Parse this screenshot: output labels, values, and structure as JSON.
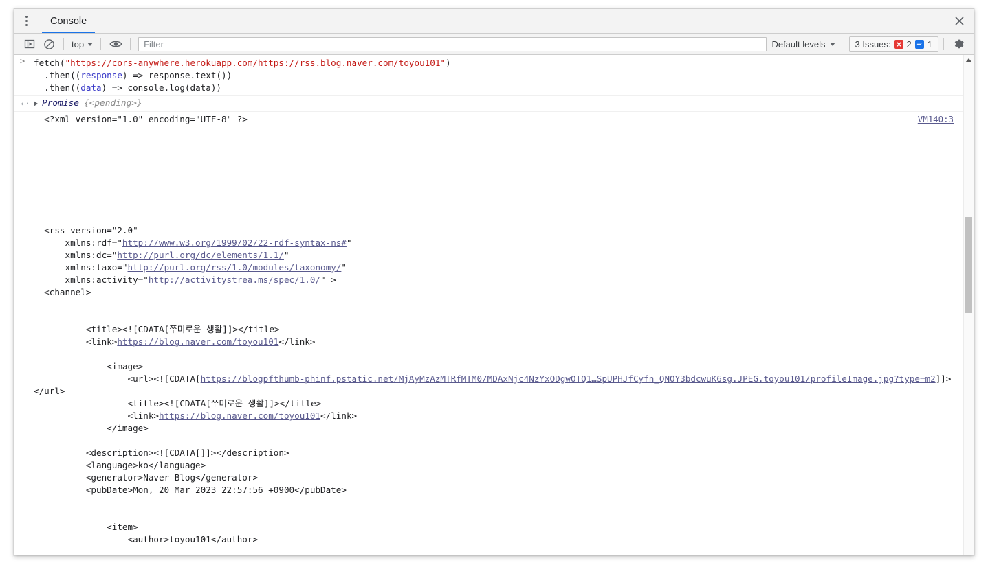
{
  "window": {
    "close_label": "×"
  },
  "tabstrip": {
    "menu_name": "more-options",
    "tabs": [
      {
        "label": "Console",
        "active": true
      }
    ]
  },
  "toolbar": {
    "sidebar_toggle_title": "Show console sidebar",
    "clear_title": "Clear console",
    "context_value": "top",
    "eye_title": "Create live expression",
    "filter_value": "",
    "filter_placeholder": "Filter",
    "levels_label": "Default levels",
    "issues_label": "3 Issues:",
    "issues_error_count": "2",
    "issues_info_count": "1",
    "settings_title": "Console settings"
  },
  "colors": {
    "accent": "#1a73e8",
    "error_badge": "#e53935",
    "info_badge": "#1a73e8",
    "string_token": "#c41a16",
    "variable_token": "#3b3bc9",
    "link": "#5a5a8e",
    "toolbar_bg": "#f3f3f3"
  },
  "console": {
    "command": {
      "gutter": ">",
      "lines": [
        [
          {
            "t": "plain",
            "v": "fetch("
          },
          {
            "t": "str",
            "v": "\"https://cors-anywhere.herokuapp.com/https://rss.blog.naver.com/toyou101\""
          },
          {
            "t": "plain",
            "v": ")"
          }
        ],
        [
          {
            "t": "plain",
            "v": "  .then(("
          },
          {
            "t": "var",
            "v": "response"
          },
          {
            "t": "plain",
            "v": ") => response.text())"
          }
        ],
        [
          {
            "t": "plain",
            "v": "  .then(("
          },
          {
            "t": "var",
            "v": "data"
          },
          {
            "t": "plain",
            "v": ") => console.log(data))"
          }
        ]
      ]
    },
    "result": {
      "gutter": "‹·",
      "name": "Promise",
      "value": "{<pending>}"
    },
    "output": {
      "source_link": "VM140:3",
      "segments": [
        {
          "k": "text",
          "v": "  <?xml version=\"1.0\" encoding=\"UTF-8\" ?>\n\n\n\n\n\n\n\n\n  <rss version=\"2.0\"\n      xmlns:rdf=\""
        },
        {
          "k": "link",
          "v": "http://www.w3.org/1999/02/22-rdf-syntax-ns#"
        },
        {
          "k": "text",
          "v": "\"\n      xmlns:dc=\""
        },
        {
          "k": "link",
          "v": "http://purl.org/dc/elements/1.1/"
        },
        {
          "k": "text",
          "v": "\"\n      xmlns:taxo=\""
        },
        {
          "k": "link",
          "v": "http://purl.org/rss/1.0/modules/taxonomy/"
        },
        {
          "k": "text",
          "v": "\"\n      xmlns:activity=\""
        },
        {
          "k": "link",
          "v": "http://activitystrea.ms/spec/1.0/"
        },
        {
          "k": "text",
          "v": "\" >\n  <channel>\n\n\n          <title><![CDATA[쭈미로운 생활]]></title>\n          <link>"
        },
        {
          "k": "link",
          "v": "https://blog.naver.com/toyou101"
        },
        {
          "k": "text",
          "v": "</link>\n\n              <image>\n                  <url><![CDATA["
        },
        {
          "k": "link",
          "v": "https://blogpfthumb-phinf.pstatic.net/MjAyMzAzMTRfMTM0/MDAxNjc4NzYxODgwOTQ1…SpUPHJfCyfn_QNOY3bdcwuK6sg.JPEG.toyou101/profileImage.jpg?type=m2"
        },
        {
          "k": "text",
          "v": "]]></url>\n                  <title><![CDATA[쭈미로운 생활]]></title>\n                  <link>"
        },
        {
          "k": "link",
          "v": "https://blog.naver.com/toyou101"
        },
        {
          "k": "text",
          "v": "</link>\n              </image>\n\n          <description><![CDATA[]]></description>\n          <language>ko</language>\n          <generator>Naver Blog</generator>\n          <pubDate>Mon, 20 Mar 2023 22:57:56 +0900</pubDate>\n\n\n              <item>\n                  <author>toyou101</author>"
        }
      ]
    }
  },
  "scrollbar": {
    "up_arrow_name": "scroll-up-arrow",
    "thumb_name": "scrollbar-thumb"
  }
}
